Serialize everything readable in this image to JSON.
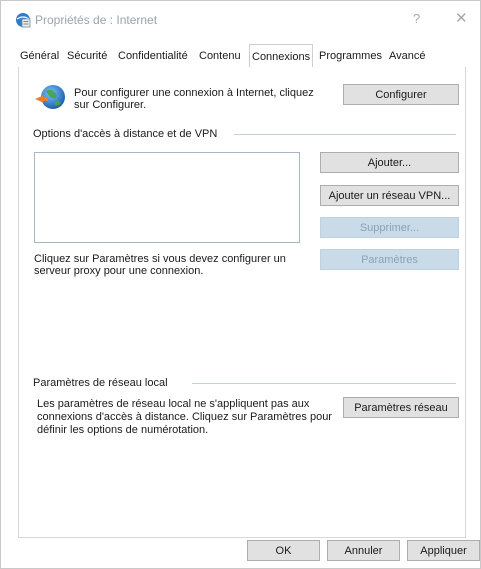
{
  "window": {
    "title": "Propriétés de : Internet",
    "help_glyph": "?",
    "close_glyph": "✕"
  },
  "tabs": [
    {
      "label": "Général"
    },
    {
      "label": "Sécurité"
    },
    {
      "label": "Confidentialité"
    },
    {
      "label": "Contenu"
    },
    {
      "label": "Connexions",
      "active": true
    },
    {
      "label": "Programmes"
    },
    {
      "label": "Avancé"
    }
  ],
  "setup": {
    "icon": "globe-connection-icon",
    "text_line1": "Pour configurer une connexion à Internet, cliquez",
    "text_line2": "sur Configurer.",
    "configure_label": "Configurer"
  },
  "dialup": {
    "group_label": "Options d'accès à distance et de VPN",
    "add_label": "Ajouter...",
    "add_vpn_label": "Ajouter un réseau VPN...",
    "remove_label": "Supprimer...",
    "settings_label": "Paramètres",
    "proxy_hint_line1": "Cliquez sur Paramètres si vous devez configurer un",
    "proxy_hint_line2": "serveur proxy pour une connexion."
  },
  "lan": {
    "group_label": "Paramètres de réseau local",
    "text_line1": "Les paramètres de réseau local ne s'appliquent pas aux",
    "text_line2": "connexions d'accès à distance. Cliquez sur Paramètres pour",
    "text_line3": "définir les options de numérotation.",
    "settings_label": "Paramètres réseau"
  },
  "footer": {
    "ok_label": "OK",
    "cancel_label": "Annuler",
    "apply_label": "Appliquer"
  },
  "colors": {
    "disabled_button": "#c9dbe8",
    "button_face": "#e1e1e1",
    "group_line": "#c4d0dc"
  }
}
